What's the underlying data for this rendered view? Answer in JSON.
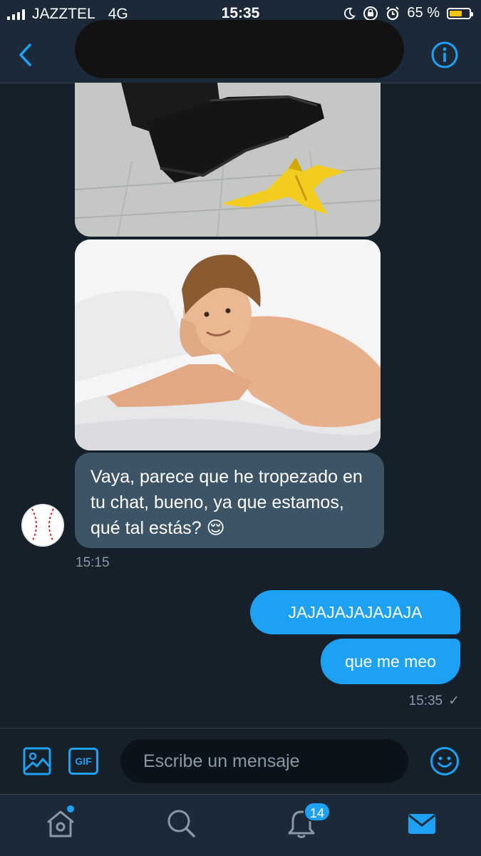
{
  "status_bar": {
    "carrier": "JAZZTEL",
    "network": "4G",
    "time": "15:35",
    "battery_percent": "65 %",
    "battery_level": 0.65
  },
  "header": {
    "title_redacted": true
  },
  "messages": {
    "incoming": {
      "text": "Vaya, parece que he tropezado en tu chat, bueno, ya que estamos, qué tal estás? 😌",
      "timestamp": "15:15"
    },
    "outgoing": [
      {
        "text": "JAJAJAJAJAJAJA"
      },
      {
        "text": "que me meo"
      }
    ],
    "outgoing_timestamp": "15:35",
    "read_mark": "✓"
  },
  "composer": {
    "placeholder": "Escribe un mensaje",
    "gif_label": "GIF"
  },
  "tabbar": {
    "notifications_badge": "14"
  },
  "colors": {
    "background": "#15202b",
    "bar": "#1c2938",
    "accent": "#1da1f2",
    "incoming_bubble": "#3d5466",
    "muted_text": "#8899a6"
  },
  "icons": [
    "back-arrow-icon",
    "info-icon",
    "image-icon",
    "gif-icon",
    "emoji-icon",
    "home-icon",
    "search-icon",
    "bell-icon",
    "mail-icon"
  ]
}
